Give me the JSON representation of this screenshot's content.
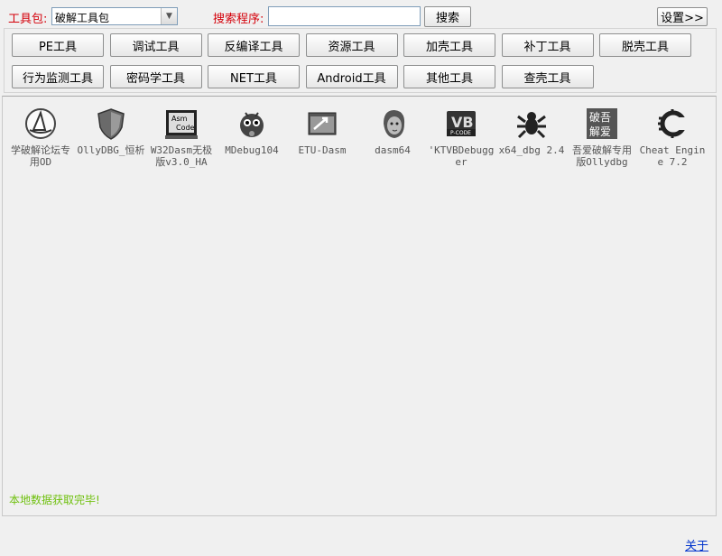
{
  "toolbar": {
    "toolkit_label": "工具包:",
    "toolkit_value": "破解工具包",
    "search_label": "搜索程序:",
    "search_value": "",
    "search_button": "搜索",
    "settings_button": "设置>>"
  },
  "categories": [
    {
      "label": "PE工具"
    },
    {
      "label": "调试工具"
    },
    {
      "label": "反编译工具"
    },
    {
      "label": "资源工具"
    },
    {
      "label": "加壳工具"
    },
    {
      "label": "补丁工具"
    },
    {
      "label": "脱壳工具"
    },
    {
      "label": "行为监测工具"
    },
    {
      "label": "密码学工具"
    },
    {
      "label": "NET工具"
    },
    {
      "label": "Android工具"
    },
    {
      "label": "其他工具"
    },
    {
      "label": "查壳工具"
    }
  ],
  "tools": [
    {
      "label": "学破解论坛专用OD",
      "icon": "shark-fin-icon"
    },
    {
      "label": "OllyDBG_恒析",
      "icon": "shield-icon"
    },
    {
      "label": "W32Dasm无极版v3.0_HA",
      "icon": "asm-code-icon"
    },
    {
      "label": "MDebug104",
      "icon": "bug-ball-icon"
    },
    {
      "label": "ETU-Dasm",
      "icon": "window-arrow-icon"
    },
    {
      "label": "dasm64",
      "icon": "face-icon"
    },
    {
      "label": "'KTVBDebugger",
      "icon": "vb-pcode-icon"
    },
    {
      "label": "x64_dbg 2.4",
      "icon": "spider-icon"
    },
    {
      "label": "吾爱破解专用版Ollydbg",
      "icon": "52pojie-logo-icon"
    },
    {
      "label": "Cheat Engine 7.2",
      "icon": "cheat-engine-icon"
    }
  ],
  "status": "本地数据获取完毕!",
  "footer": {
    "about_link": "关于"
  }
}
